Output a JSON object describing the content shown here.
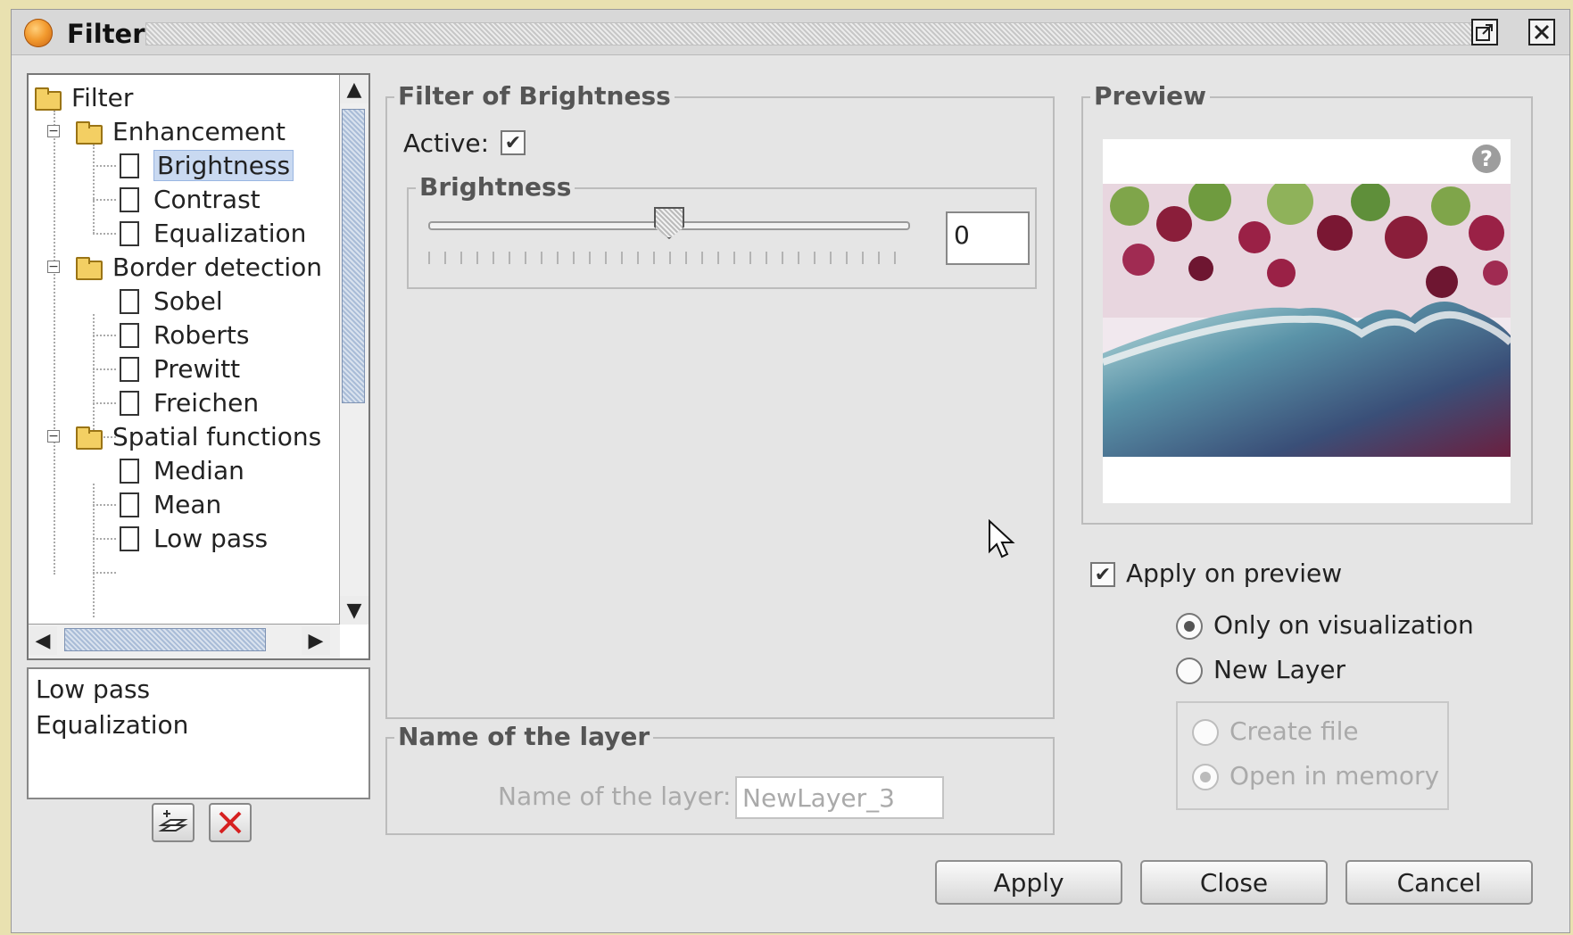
{
  "window": {
    "title": "Filter"
  },
  "tree": {
    "root": "Filter",
    "enhancement": {
      "label": "Enhancement",
      "items": [
        "Brightness",
        "Contrast",
        "Equalization"
      ]
    },
    "border_detection": {
      "label": "Border detection",
      "items": [
        "Sobel",
        "Roberts",
        "Prewitt",
        "Freichen"
      ]
    },
    "spatial_functions": {
      "label": "Spatial functions",
      "items": [
        "Median",
        "Mean",
        "Low pass"
      ]
    },
    "selected": "Brightness"
  },
  "applied_filters": [
    "Low pass",
    "Equalization"
  ],
  "filter_panel": {
    "legend": "Filter of Brightness",
    "active_label": "Active:",
    "active_checked": true,
    "brightness_legend": "Brightness",
    "brightness_value": "0",
    "brightness_fraction": 0.5
  },
  "layer_panel": {
    "legend": "Name of the layer",
    "label": "Name of the layer:",
    "value": "NewLayer_3"
  },
  "preview": {
    "legend": "Preview",
    "help_icon": "?",
    "apply_on_preview": "Apply on preview",
    "apply_on_preview_checked": true,
    "only_on_visualization": "Only on visualization",
    "new_layer": "New Layer",
    "create_file": "Create file",
    "open_in_memory": "Open in memory"
  },
  "buttons": {
    "apply": "Apply",
    "close": "Close",
    "cancel": "Cancel"
  },
  "icons": {
    "app": "sextante-logo-icon",
    "maximize": "maximize-icon",
    "close": "close-window-icon",
    "add_layer": "add-layer-icon",
    "delete": "delete-icon"
  },
  "colors": {
    "selection": "#c9d9f1",
    "delete_red": "#d62020",
    "app_orange": "#f29a2e"
  }
}
